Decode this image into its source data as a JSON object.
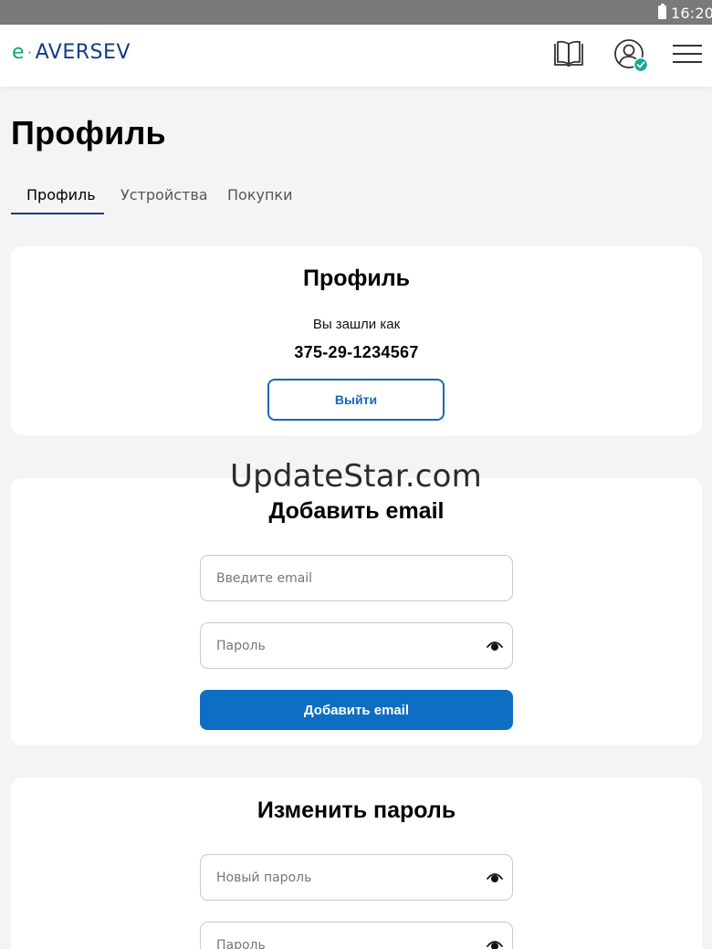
{
  "status_bar": {
    "time": "16:20"
  },
  "header": {
    "logo": {
      "prefix": "e",
      "brand": "AVERSEV"
    },
    "icons": [
      "book-icon",
      "user-verified-icon",
      "hamburger-menu-icon"
    ]
  },
  "page": {
    "title": "Профиль"
  },
  "tabs": [
    {
      "label": "Профиль",
      "active": true
    },
    {
      "label": "Устройства",
      "active": false
    },
    {
      "label": "Покупки",
      "active": false
    }
  ],
  "profile_card": {
    "title": "Профиль",
    "logged_in_label": "Вы зашли как",
    "phone": "375-29-1234567",
    "logout_label": "Выйти"
  },
  "email_card": {
    "title": "Добавить email",
    "email_placeholder": "Введите email",
    "password_placeholder": "Пароль",
    "submit_label": "Добавить email"
  },
  "password_card": {
    "title": "Изменить пароль",
    "new_password_placeholder": "Новый пароль",
    "password_placeholder": "Пароль"
  },
  "watermark": "UpdateStar.com",
  "colors": {
    "primary": "#0d6ec3",
    "tab_underline": "#1a3a7c",
    "logo_green": "#13a46a",
    "logo_blue": "#0e3d8a",
    "verified_badge": "#13a88f"
  }
}
